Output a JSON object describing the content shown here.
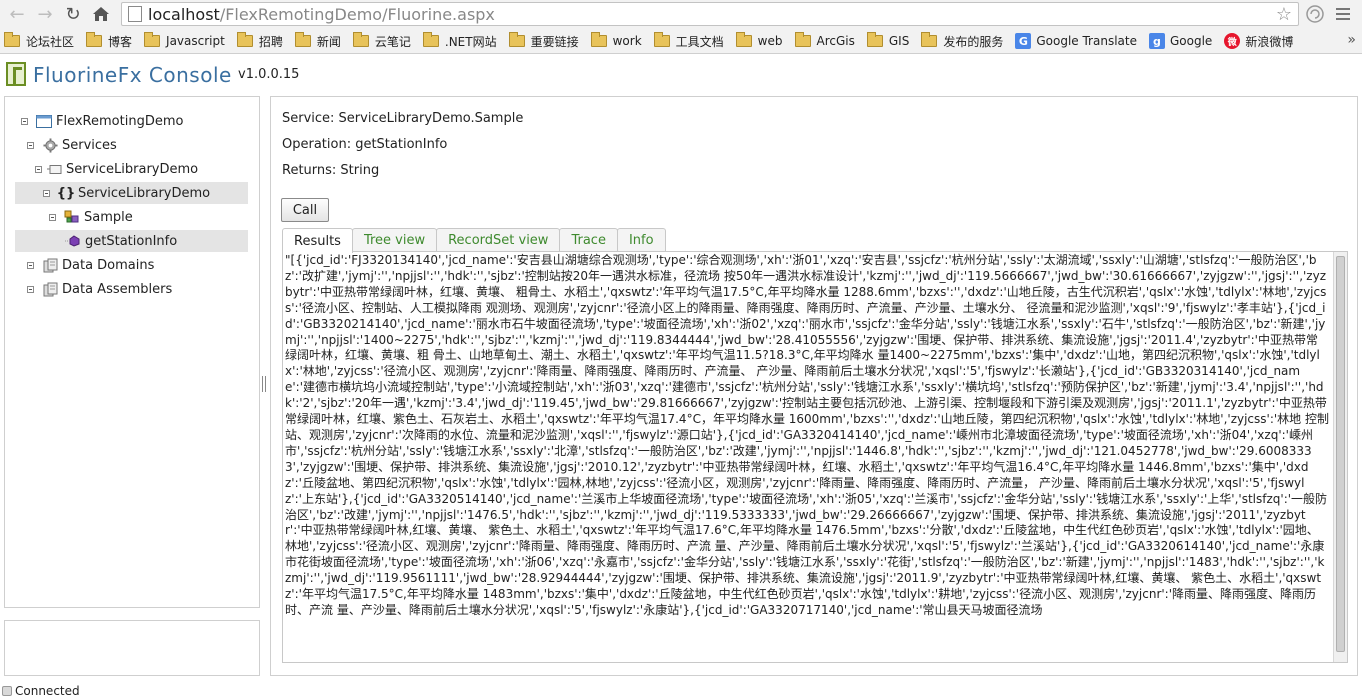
{
  "browser": {
    "url_host": "localhost",
    "url_path": "/FlexRemotingDemo/Fluorine.aspx",
    "bookmarks": [
      {
        "label": "论坛社区",
        "icon": "folder-icon"
      },
      {
        "label": "博客",
        "icon": "folder-icon"
      },
      {
        "label": "Javascript",
        "icon": "folder-icon"
      },
      {
        "label": "招聘",
        "icon": "folder-icon"
      },
      {
        "label": "新闻",
        "icon": "folder-icon"
      },
      {
        "label": "云笔记",
        "icon": "folder-icon"
      },
      {
        "label": ".NET网站",
        "icon": "folder-icon"
      },
      {
        "label": "重要链接",
        "icon": "folder-icon"
      },
      {
        "label": "work",
        "icon": "folder-icon"
      },
      {
        "label": "工具文档",
        "icon": "folder-icon"
      },
      {
        "label": "web",
        "icon": "folder-icon"
      },
      {
        "label": "ArcGis",
        "icon": "folder-icon"
      },
      {
        "label": "GIS",
        "icon": "folder-icon"
      },
      {
        "label": "发布的服务",
        "icon": "folder-icon"
      },
      {
        "label": "Google Translate",
        "icon": "google-translate-icon"
      },
      {
        "label": "Google",
        "icon": "google-icon"
      },
      {
        "label": "新浪微博",
        "icon": "weibo-icon"
      }
    ],
    "more_bookmarks": "»"
  },
  "app": {
    "title": "FluorineFx Console",
    "version": "v1.0.0.15"
  },
  "tree": {
    "items": [
      {
        "label": "FlexRemotingDemo",
        "icon": "app-window-icon"
      },
      {
        "label": "Services",
        "icon": "gear-icon"
      },
      {
        "label": "ServiceLibraryDemo",
        "icon": "assembly-icon"
      },
      {
        "label": "ServiceLibraryDemo",
        "icon": "namespace-braces-icon"
      },
      {
        "label": "Sample",
        "icon": "class-icon"
      },
      {
        "label": "getStationInfo",
        "icon": "method-icon"
      },
      {
        "label": "Data Domains",
        "icon": "database-icon"
      },
      {
        "label": "Data Assemblers",
        "icon": "database-icon"
      }
    ]
  },
  "details": {
    "service": "Service: ServiceLibraryDemo.Sample",
    "operation": "Operation: getStationInfo",
    "returns": "Returns: String",
    "call_label": "Call"
  },
  "tabs": [
    "Results",
    "Tree view",
    "RecordSet view",
    "Trace",
    "Info"
  ],
  "results_text": "\"[{'jcd_id':'FJ3320134140','jcd_name':'安吉县山湖塘综合观测场','type':'综合观测场','xh':'浙01','xzq':'安吉县','ssjcfz':'杭州分站','ssly':'太湖流域','ssxly':'山湖塘','stlsfzq':'一般防治区','bz':'改扩建','jymj':'','npjjsl':'','hdk':'','sjbz':'控制站按20年一遇洪水标准，径流场 按50年一遇洪水标准设计','kzmj':'','jwd_dj':'119.5666667','jwd_bw':'30.61666667','zyjgzw':'','jgsj':'','zyzbytr':'中亚热带常绿阔叶林，红壤、黄壤、 粗骨土、水稻土','qxswtz':'年平均气温17.5°C,年平均降水量 1288.6mm','bzxs':'','dxdz':'山地丘陵，古生代沉积岩','qslx':'水蚀','tdlylx':'林地','zyjcss':'径流小区、控制站、人工模拟降雨 观测场、观测房','zyjcnr':'径流小区上的降雨量、降雨强度、降雨历时、产流量、产沙量、土壤水分、 径流量和泥沙监测','xqsl':'9','fjswylz':'孝丰站'},{'jcd_id':'GB3320214140','jcd_name':'丽水市石牛坡面径流场','type':'坡面径流场','xh':'浙02','xzq':'丽水市','ssjcfz':'金华分站','ssly':'钱塘江水系','ssxly':'石牛','stlsfzq':'一般防治区','bz':'新建','jymj':'','npjjsl':'1400~2275','hdk':'','sjbz':'','kzmj':'','jwd_dj':'119.8344444','jwd_bw':'28.41055556','zyjgzw':'围埂、保护带、排洪系统、集流设施','jgsj':'2011.4','zyzbytr':'中亚热带常绿阔叶林，红壤、黄壤、粗 骨土、山地草甸土、潮土、水稻土','qxswtz':'年平均气温11.5?18.3°C,年平均降水 量1400~2275mm','bzxs':'集中','dxdz':'山地，第四纪沉积物','qslx':'水蚀','tdlylx':'林地','zyjcss':'径流小区、观测房','zyjcnr':'降雨量、降雨强度、降雨历时、产流量、 产沙量、降雨前后土壤水分状况','xqsl':'5','fjswylz':'长濑站'},{'jcd_id':'GB3320314140','jcd_name':'建德市横坑坞小流域控制站','type':'小流域控制站','xh':'浙03','xzq':'建德市','ssjcfz':'杭州分站','ssly':'钱塘江水系','ssxly':'横坑坞','stlsfzq':'预防保护区','bz':'新建','jymj':'3.4','npjjsl':'','hdk':'2','sjbz':'20年一遇','kzmj':'3.4','jwd_dj':'119.45','jwd_bw':'29.81666667','zyjgzw':'控制站主要包括沉砂池、上游引渠、控制堰段和下游引渠及观测房','jgsj':'2011.1','zyzbytr':'中亚热带常绿阔叶林，红壤、紫色土、石灰岩土、水稻土','qxswtz':'年平均气温17.4°C，年平均降水量 1600mm','bzxs':'','dxdz':'山地丘陵，第四纪沉积物','qslx':'水蚀','tdlylx':'林地','zyjcss':'林地 控制站、观测房','zyjcnr':'次降雨的水位、流量和泥沙监测','xqsl':'','fjswylz':'源口站'},{'jcd_id':'GA3320414140','jcd_name':'嵊州市北漳坡面径流场','type':'坡面径流场','xh':'浙04','xzq':'嵊州市','ssjcfz':'杭州分站','ssly':'钱塘江水系','ssxly':'北漳','stlsfzq':'一般防治区','bz':'改建','jymj':'','npjjsl':'1446.8','hdk':'','sjbz':'','kzmj':'','jwd_dj':'121.0452778','jwd_bw':'29.60083333','zyjgzw':'围埂、保护带、排洪系统、集流设施','jgsj':'2010.12','zyzbytr':'中亚热带常绿阔叶林，红壤、水稻土','qxswtz':'年平均气温16.4°C,年平均降水量 1446.8mm','bzxs':'集中','dxdz':'丘陵盆地、第四纪沉积物','qslx':'水蚀','tdlylx':'园林,林地','zyjcss':'径流小区，观测房','zyjcnr':'降雨量、降雨强度、降雨历时、产流量， 产沙量、降雨前后土壤水分状况','xqsl':'5','fjswylz':'上东站'},{'jcd_id':'GA3320514140','jcd_name':'兰溪市上华坡面径流场','type':'坡面径流场','xh':'浙05','xzq':'兰溪市','ssjcfz':'金华分站','ssly':'钱塘江水系','ssxly':'上华','stlsfzq':'一般防治区','bz':'改建','jymj':'','npjjsl':'1476.5','hdk':'','sjbz':'','kzmj':'','jwd_dj':'119.5333333','jwd_bw':'29.26666667','zyjgzw':'围埂、保护带、排洪系统、集流设施','jgsj':'2011','zyzbytr':'中亚热带常绿阔叶林,红壤、黄壤、 紫色土、水稻土','qxswtz':'年平均气温17.6°C,年平均降水量 1476.5mm','bzxs':'分散','dxdz':'丘陵盆地，中生代红色砂页岩','qslx':'水蚀','tdlylx':'园地、林地','zyjcss':'径流小区、观测房','zyjcnr':'降雨量、降雨强度、降雨历时、产流 量、产沙量、降雨前后土壤水分状况','xqsl':'5','fjswylz':'兰溪站'},{'jcd_id':'GA3320614140','jcd_name':'永康市花街坡面径流场','type':'坡面径流场','xh':'浙06','xzq':'永嘉市','ssjcfz':'金华分站','ssly':'钱塘江水系','ssxly':'花街','stlsfzq':'一般防治区','bz':'新建','jymj':'','npjjsl':'1483','hdk':'','sjbz':'','kzmj':'','jwd_dj':'119.9561111','jwd_bw':'28.92944444','zyjgzw':'围埂、保护带、排洪系统、集流设施','jgsj':'2011.9','zyzbytr':'中亚热带常绿阔叶林,红壤、黄壤、 紫色土、水稻土','qxswtz':'年平均气温17.5°C,年平均降水量 1483mm','bzxs':'集中','dxdz':'丘陵盆地，中生代红色砂页岩','qslx':'水蚀','tdlylx':'耕地','zyjcss':'径流小区、观测房','zyjcnr':'降雨量、降雨强度、降雨历时、产流 量、产沙量、降雨前后土壤水分状况','xqsl':'5','fjswylz':'永康站'},{'jcd_id':'GA3320717140','jcd_name':'常山县天马坡面径流场",
  "status": "Connected"
}
